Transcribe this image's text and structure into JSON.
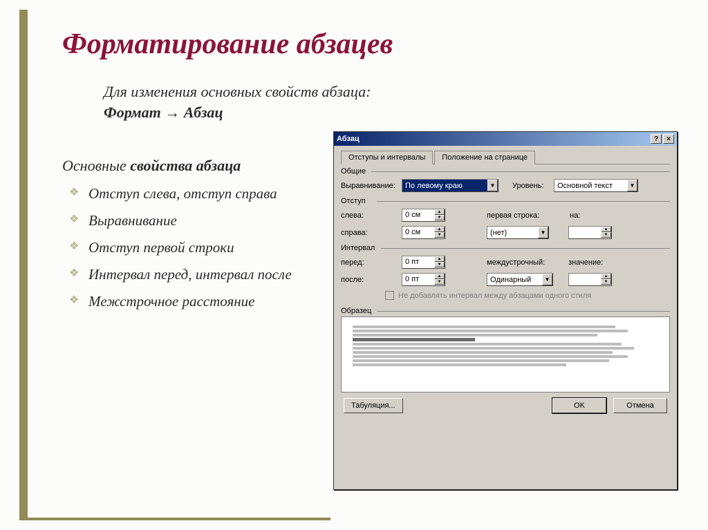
{
  "title": "Форматирование абзацев",
  "subtitle": {
    "line1": "Для изменения основных свойств абзаца:",
    "bold1": "Формат",
    "arrow": " → ",
    "bold2": "Абзац"
  },
  "listHeading": {
    "pre": "Основные ",
    "bold": "свойства абзаца"
  },
  "props": [
    "Отступ слева, отступ справа",
    "Выравнивание",
    "Отступ первой строки",
    "Интервал перед, интервал после",
    "Межстрочное расстояние"
  ],
  "dialog": {
    "title": "Абзац",
    "help": "?",
    "close": "×",
    "tabs": {
      "t1": "Отступы и интервалы",
      "t2": "Положение на странице"
    },
    "groups": {
      "general": "Общие",
      "indent": "Отступ",
      "interval": "Интервал",
      "sample": "Образец"
    },
    "labels": {
      "align": "Выравнивание:",
      "level": "Уровень:",
      "left": "слева:",
      "right": "справа:",
      "firstLine": "первая строка:",
      "by": "на:",
      "before": "перед:",
      "after": "после:",
      "lineSpacing": "междустрочный:",
      "value": "значение:"
    },
    "values": {
      "align": "По левому краю",
      "level": "Основной текст",
      "left": "0 см",
      "right": "0 см",
      "firstLine": "(нет)",
      "by": "",
      "before": "0 пт",
      "after": "0 пт",
      "lineSpacing": "Одинарный",
      "value": ""
    },
    "checkbox": "Не добавлять интервал между абзацами одного стиля",
    "buttons": {
      "tabs": "Табуляция...",
      "ok": "OK",
      "cancel": "Отмена"
    }
  }
}
